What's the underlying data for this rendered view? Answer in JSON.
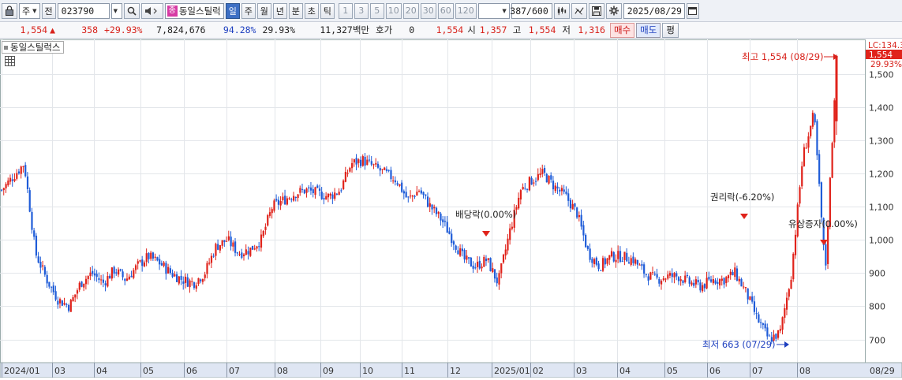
{
  "toolbar": {
    "lock_icon": "lock-icon",
    "market_select": "주",
    "prev_label": "전",
    "code": "023790",
    "search_icon": "search-icon",
    "speaker_icon": "speaker-icon",
    "stock_tag": "종",
    "stock_name": "동일스틸럭",
    "periods": [
      "일",
      "주",
      "월",
      "년",
      "분",
      "초",
      "틱"
    ],
    "active_period": "일",
    "minute_options": [
      "1",
      "3",
      "5",
      "10",
      "20",
      "30",
      "60",
      "120"
    ],
    "count": "387/600",
    "date": "2025/08/29"
  },
  "quote": {
    "price": "1,554",
    "change": "358",
    "change_pct": "+29.93%",
    "volume": "7,824,676",
    "vol_ratio": "94.28%",
    "rate": "29.93%",
    "amount": "11,327백만",
    "hoga_label": "호가",
    "hoga_value": "0",
    "ask": "1,554",
    "open_label": "시",
    "open": "1,357",
    "high_label": "고",
    "high": "1,554",
    "low_label": "저",
    "low": "1,316",
    "buy_label": "매수",
    "sell_label": "매도",
    "avg_label": "평"
  },
  "legend": {
    "title": "동일스틸럭스"
  },
  "chart_data": {
    "type": "candlestick",
    "title": "동일스틸럭스",
    "y_ticks": [
      700,
      800,
      900,
      1000,
      1100,
      1200,
      1300,
      1400,
      1500
    ],
    "y_tick_labels": [
      "700",
      "800",
      "900",
      "1,000",
      "1,100",
      "1,200",
      "1,300",
      "1,400",
      "1,500"
    ],
    "ylim": [
      630,
      1575
    ],
    "x_labels": [
      "2024/01",
      "03",
      "04",
      "05",
      "06",
      "07",
      "08",
      "09",
      "10",
      "11",
      "12",
      "2025/01",
      "02",
      "03",
      "04",
      "05",
      "06",
      "07",
      "08"
    ],
    "x_last_label": "08/29",
    "series": [
      {
        "points": [
          1150,
          1190,
          1230,
          960,
          880,
          820,
          800,
          870,
          900,
          870,
          910,
          880,
          920,
          950,
          930,
          900,
          880,
          870,
          900,
          980,
          1000,
          960,
          970,
          1000,
          1100,
          1120,
          1140,
          1150,
          1140,
          1130,
          1150,
          1230,
          1240,
          1220,
          1200,
          1180,
          1120,
          1150,
          1100,
          1060,
          1000,
          940,
          920,
          940,
          870,
          1020,
          1150,
          1180,
          1200,
          1160,
          1130,
          1080,
          960,
          920,
          950,
          950,
          940,
          900,
          880,
          890,
          890,
          870,
          860,
          880,
          880,
          900,
          840,
          760,
          700,
          720,
          900,
          1250,
          1380,
          900,
          1554
        ]
      }
    ],
    "up_color": "#e0231b",
    "down_color": "#1f5cd8",
    "annotations": [
      {
        "text": "최고 1,554 (08/29)",
        "value": 1554,
        "color": "#d8221b"
      },
      {
        "text": "최저 663 (07/29)",
        "value": 663,
        "color": "#1d3fbf"
      },
      {
        "text": "배당락(0.00%)",
        "color": "#222"
      },
      {
        "text": "권리락(-6.20%)",
        "color": "#222"
      },
      {
        "text": "유상증자(0.00%)",
        "color": "#222"
      }
    ],
    "right_labels": {
      "lc": "LC:134.3",
      "price": "1,554",
      "pct": "29.93%"
    }
  }
}
